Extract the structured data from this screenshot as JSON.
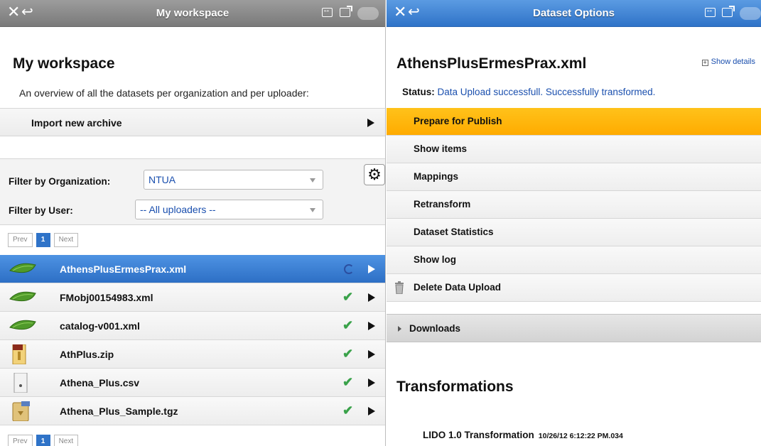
{
  "left": {
    "window_title": "My workspace",
    "heading": "My workspace",
    "intro": "An overview of all the datasets per organization and per uploader:",
    "import_label": "Import new archive",
    "filter_org_label": "Filter by Organization:",
    "filter_org_value": "NTUA",
    "filter_user_label": "Filter by User:",
    "filter_user_value": "-- All uploaders --",
    "pager": {
      "prev": "Prev",
      "page": "1",
      "next": "Next"
    },
    "files": [
      {
        "name": "AthensPlusErmesPrax.xml",
        "type": "xml",
        "status": "processing",
        "selected": true
      },
      {
        "name": "FMobj00154983.xml",
        "type": "xml",
        "status": "ok",
        "selected": false
      },
      {
        "name": "catalog-v001.xml",
        "type": "xml",
        "status": "ok",
        "selected": false
      },
      {
        "name": "AthPlus.zip",
        "type": "zip",
        "status": "ok",
        "selected": false
      },
      {
        "name": "Athena_Plus.csv",
        "type": "csv",
        "status": "ok",
        "selected": false
      },
      {
        "name": "Athena_Plus_Sample.tgz",
        "type": "tgz",
        "status": "ok",
        "selected": false
      }
    ]
  },
  "right": {
    "window_title": "Dataset Options",
    "dataset_name": "AthensPlusErmesPrax.xml",
    "show_details": "Show details",
    "status_label": "Status:",
    "status_text": "Data Upload successfull. Successfully transformed.",
    "options": [
      {
        "label": "Prepare for Publish",
        "active": true
      },
      {
        "label": "Show items",
        "active": false
      },
      {
        "label": "Mappings",
        "active": false
      },
      {
        "label": "Retransform",
        "active": false
      },
      {
        "label": "Dataset Statistics",
        "active": false
      },
      {
        "label": "Show log",
        "active": false
      },
      {
        "label": "Delete Data Upload",
        "active": false
      }
    ],
    "downloads_label": "Downloads",
    "transformations_heading": "Transformations",
    "transformation": {
      "name": "LIDO 1.0 Transformation",
      "timestamp": "10/26/12 6:12:22 PM.034"
    }
  },
  "colors": {
    "accent_blue": "#2f73c8",
    "active_orange": "#ffb300",
    "link_blue": "#1a4fae",
    "ok_green": "#3aa24a"
  }
}
